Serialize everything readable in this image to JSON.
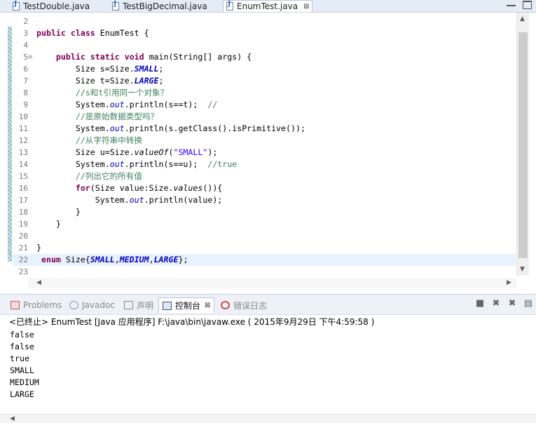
{
  "editor_tabs": [
    {
      "label": "TestDouble.java"
    },
    {
      "label": "TestBigDecimal.java"
    },
    {
      "label": "EnumTest.java",
      "close": "⊠"
    }
  ],
  "code_lines": [
    {
      "n": "2"
    },
    {
      "n": "3",
      "kw1": "public",
      "kw2": "class",
      "rest": " EnumTest {"
    },
    {
      "n": "4"
    },
    {
      "n": "5",
      "fold": "⊖",
      "kw1": "public",
      "kw2": "static",
      "kw3": "void",
      "rest": " main(String[] args) {"
    },
    {
      "n": "6",
      "a": "Size s=Size.",
      "f": "SMALL",
      "b": ";"
    },
    {
      "n": "7",
      "a": "Size t=Size.",
      "f": "LARGE",
      "b": ";"
    },
    {
      "n": "8",
      "cmt": "//s和t引用同一个对象？"
    },
    {
      "n": "9",
      "a": "System.",
      "f": "out",
      "b": ".println(s==t);  ",
      "cmt": "//"
    },
    {
      "n": "10",
      "cmt": "//是原始数据类型吗？"
    },
    {
      "n": "11",
      "a": "System.",
      "f": "out",
      "b": ".println(s.getClass().isPrimitive());"
    },
    {
      "n": "12",
      "cmt": "//从字符串中转换"
    },
    {
      "n": "13",
      "a": "Size u=Size.",
      "m": "valueOf",
      "b": "(",
      "str": "\"SMALL\"",
      "c": ");"
    },
    {
      "n": "14",
      "a": "System.",
      "f": "out",
      "b": ".println(s==u);  ",
      "cmt": "//true"
    },
    {
      "n": "15",
      "cmt": "//列出它的所有值"
    },
    {
      "n": "16",
      "kw": "for",
      "a": "(Size value:Size.",
      "m": "values",
      "b": "()){"
    },
    {
      "n": "17",
      "a": "System.",
      "f": "out",
      "b": ".println(value);"
    },
    {
      "n": "18",
      "text": "}"
    },
    {
      "n": "19",
      "text": "}"
    },
    {
      "n": "20"
    },
    {
      "n": "21",
      "text": "}"
    },
    {
      "n": "22",
      "kw": "enum",
      "a": " Size{",
      "f1": "SMALL",
      "s1": ",",
      "f2": "MEDIUM",
      "s2": ",",
      "f3": "LARGE",
      "b": "};"
    },
    {
      "n": "23"
    }
  ],
  "console": {
    "tabs": [
      {
        "label": "Problems"
      },
      {
        "label": "Javadoc"
      },
      {
        "label": "声明"
      },
      {
        "label": "控制台",
        "close": "⊠"
      },
      {
        "label": "错误日志"
      }
    ],
    "status": "<已终止> EnumTest [Java 应用程序] F:\\java\\bin\\javaw.exe ( 2015年9月29日 下午4:59:58 )",
    "output": [
      "false",
      "false",
      "true",
      "SMALL",
      "MEDIUM",
      "LARGE"
    ]
  },
  "icons": {
    "tab_java": "java-file-icon",
    "problems": "problems-icon",
    "javadoc": "javadoc-icon",
    "declaration": "declaration-icon",
    "console": "console-icon",
    "error_log": "error-log-icon"
  }
}
